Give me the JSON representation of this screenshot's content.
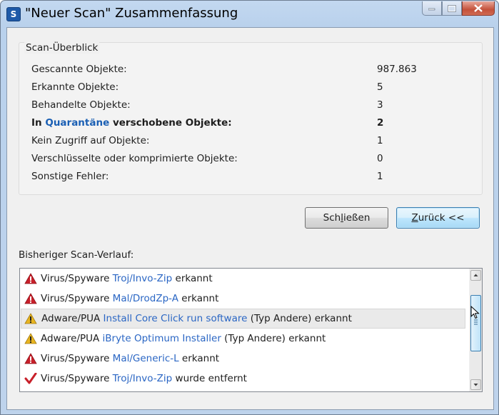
{
  "window": {
    "title": "\"Neuer Scan\" Zusammenfassung",
    "app_icon": "S",
    "accent_color": "#1f5aa8"
  },
  "overview": {
    "group_title": "Scan-Überblick",
    "rows": [
      {
        "label": "Gescannte Objekte:",
        "value": "987.863"
      },
      {
        "label": "Erkannte Objekte:",
        "value": "5"
      },
      {
        "label": "Behandelte Objekte:",
        "value": "3"
      },
      {
        "label_prefix": "In ",
        "label_link": "Quarantäne",
        "label_suffix": " verschobene Objekte:",
        "value": "2"
      },
      {
        "label": "Kein Zugriff auf Objekte:",
        "value": "1"
      },
      {
        "label": "Verschlüsselte oder komprimierte Objekte:",
        "value": "0"
      },
      {
        "label": "Sonstige Fehler:",
        "value": "1"
      }
    ]
  },
  "buttons": {
    "close_prefix": "Sch",
    "close_underlined": "l",
    "close_suffix": "ießen",
    "back_underlined": "Z",
    "back_suffix": "urück <<"
  },
  "history": {
    "label": "Bisheriger Scan-Verlauf:",
    "items": [
      {
        "icon": "error-icon",
        "prefix": "Virus/Spyware ",
        "threat": "Troj/Invo-Zip",
        "suffix": " erkannt"
      },
      {
        "icon": "error-icon",
        "prefix": "Virus/Spyware ",
        "threat": "Mal/DrodZp-A",
        "suffix": " erkannt"
      },
      {
        "icon": "warning-icon",
        "prefix": "Adware/PUA ",
        "threat": "Install Core Click run software",
        "suffix": " (Typ Andere) erkannt"
      },
      {
        "icon": "warning-icon",
        "prefix": "Adware/PUA ",
        "threat": "iBryte Optimum Installer",
        "suffix": " (Typ Andere) erkannt"
      },
      {
        "icon": "error-icon",
        "prefix": "Virus/Spyware ",
        "threat": "Mal/Generic-L",
        "suffix": " erkannt"
      },
      {
        "icon": "checkmark-icon",
        "prefix": "Virus/Spyware ",
        "threat": "Troj/Invo-Zip",
        "suffix": " wurde entfernt"
      }
    ]
  },
  "colors": {
    "threat_link": "#2a66c4",
    "error": "#c8202a",
    "warning": "#e8b520"
  }
}
